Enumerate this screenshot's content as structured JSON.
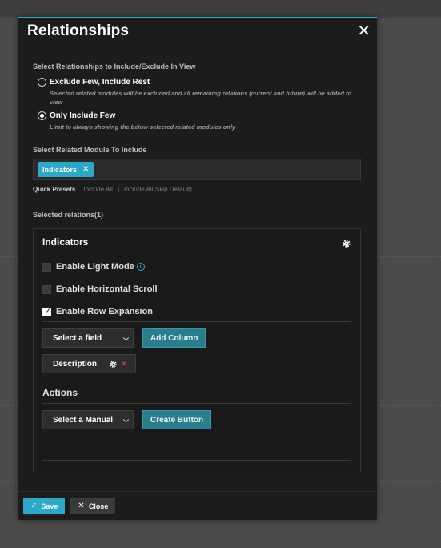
{
  "modal": {
    "title": "Relationships",
    "close_icon": "close-icon"
  },
  "include_section": {
    "title": "Select Relationships to Include/Exclude In View",
    "options": [
      {
        "label": "Exclude Few, Include Rest",
        "description": "Selected related modules will be excluded and all remaining relations (current and future) will be added to view",
        "checked": false
      },
      {
        "label": "Only Include Few",
        "description": "Limit to always showing the below selected related modules only",
        "checked": true
      }
    ]
  },
  "related_module": {
    "title": "Select Related Module To Include",
    "chips": [
      "Indicators"
    ],
    "chip_remove": "✕",
    "quick_presets_label": "Quick Presets",
    "preset_include_all": "Include All",
    "preset_separator": "|",
    "preset_include_all_skip": "Include All(Skip Default)"
  },
  "selected_relations": {
    "title": "Selected relations(1)",
    "panel": {
      "title": "Indicators",
      "options": [
        {
          "label": "Enable Light Mode",
          "checked": false,
          "info": "i"
        },
        {
          "label": "Enable Horizontal Scroll",
          "checked": false
        },
        {
          "label": "Enable Row Expansion",
          "checked": true
        }
      ],
      "field_select": "Select a field",
      "add_column": "Add Column",
      "columns": [
        "Description"
      ],
      "column_remove": "×",
      "actions_title": "Actions",
      "manual_select": "Select a Manual",
      "create_button": "Create Button"
    }
  },
  "footer": {
    "save": "Save",
    "close": "Close"
  },
  "colors": {
    "accent": "#2aa9c8",
    "teal_button": "#2a7d8c",
    "danger": "#d83c3c"
  }
}
